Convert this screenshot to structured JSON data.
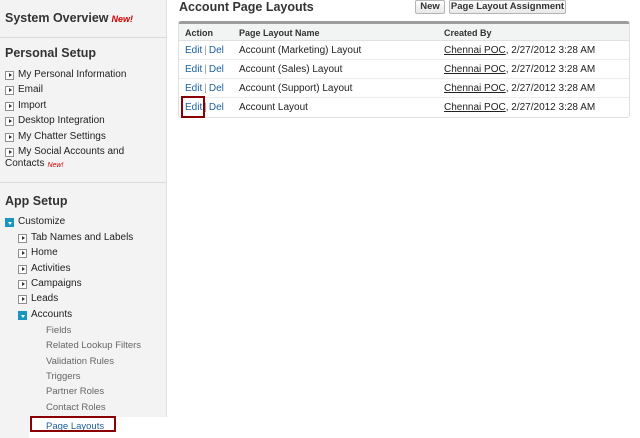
{
  "sidebar": {
    "system_overview": {
      "label": "System Overview",
      "badge": "New!"
    },
    "personal_setup": {
      "title": "Personal Setup",
      "items": [
        {
          "label": "My Personal Information"
        },
        {
          "label": "Email"
        },
        {
          "label": "Import"
        },
        {
          "label": "Desktop Integration"
        },
        {
          "label": "My Chatter Settings"
        },
        {
          "label_line1": "My Social Accounts and",
          "label_line2": "Contacts",
          "badge": "New!"
        }
      ]
    },
    "app_setup": {
      "title": "App Setup",
      "customize": {
        "label": "Customize"
      },
      "items": [
        {
          "label": "Tab Names and Labels"
        },
        {
          "label": "Home"
        },
        {
          "label": "Activities"
        },
        {
          "label": "Campaigns"
        },
        {
          "label": "Leads"
        },
        {
          "label": "Accounts"
        }
      ],
      "accounts_sub": [
        {
          "label": "Fields"
        },
        {
          "label": "Related Lookup Filters"
        },
        {
          "label": "Validation Rules"
        },
        {
          "label": "Triggers"
        },
        {
          "label": "Partner Roles"
        },
        {
          "label": "Contact Roles"
        },
        {
          "label": "Page Layouts"
        }
      ]
    }
  },
  "main": {
    "title": "Account Page Layouts",
    "buttons": {
      "new": "New",
      "assignment": "Page Layout Assignment"
    },
    "table": {
      "headers": {
        "action": "Action",
        "name": "Page Layout Name",
        "created_by": "Created By"
      },
      "rows": [
        {
          "edit": "Edit",
          "del": "Del",
          "sep": "|",
          "name": "Account (Marketing) Layout",
          "creator": "Chennai POC",
          "date": ", 2/27/2012 3:28 AM"
        },
        {
          "edit": "Edit",
          "del": "Del",
          "sep": "|",
          "name": "Account (Sales) Layout",
          "creator": "Chennai POC",
          "date": ", 2/27/2012 3:28 AM"
        },
        {
          "edit": "Edit",
          "del": "Del",
          "sep": "|",
          "name": "Account (Support) Layout",
          "creator": "Chennai POC",
          "date": ", 2/27/2012 3:28 AM"
        },
        {
          "edit": "Edit",
          "del": "Del",
          "sep": "|",
          "name": "Account Layout",
          "creator": "Chennai POC",
          "date": ", 2/27/2012 3:28 AM"
        }
      ]
    }
  },
  "colors": {
    "link": "#1a5f9e",
    "new_badge": "#d40000",
    "highlight": "#8b0000",
    "expanded_box": "#1797c0"
  }
}
